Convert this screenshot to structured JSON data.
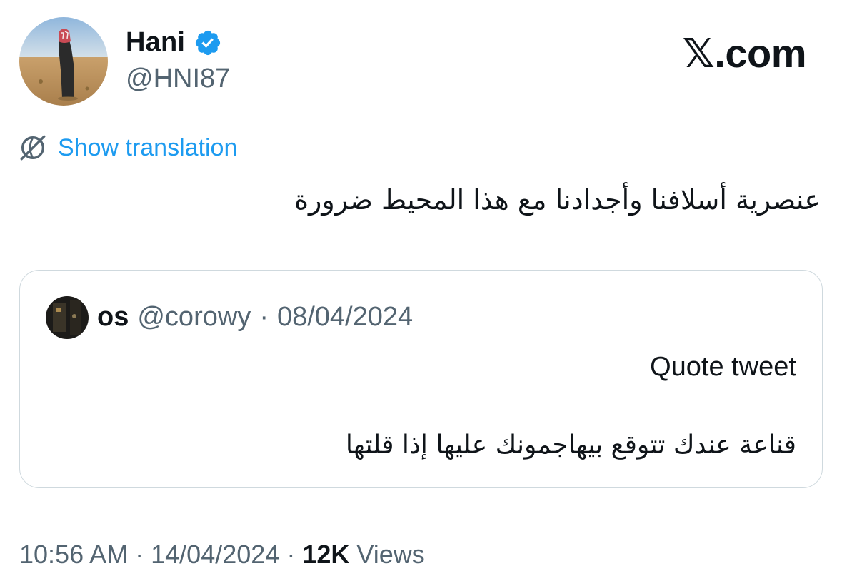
{
  "author": {
    "display_name": "Hani",
    "handle": "@HNI87",
    "verified_icon": "verified-badge-icon",
    "badge_color": "#1d9bf0"
  },
  "brand": {
    "logo_text": "𝕏",
    "logo_suffix": ".com"
  },
  "translation": {
    "icon": "globe-translate-icon",
    "label": "Show translation"
  },
  "tweet": {
    "text": "عنصرية أسلافنا وأجدادنا مع هذا المحيط ضرورة"
  },
  "quote": {
    "author_name": "os",
    "handle": "@corowy",
    "separator": "·",
    "date": "08/04/2024",
    "label": "Quote tweet",
    "text": "قناعة عندك تتوقع بيهاجمونك عليها إذا قلتها"
  },
  "footer": {
    "time": "10:56 AM",
    "separator1": "·",
    "date": "14/04/2024",
    "separator2": "·",
    "views_count": "12K",
    "views_label": "Views"
  },
  "colors": {
    "text_primary": "#0f1419",
    "text_secondary": "#536471",
    "link": "#1d9bf0",
    "border": "#cfd9de"
  }
}
